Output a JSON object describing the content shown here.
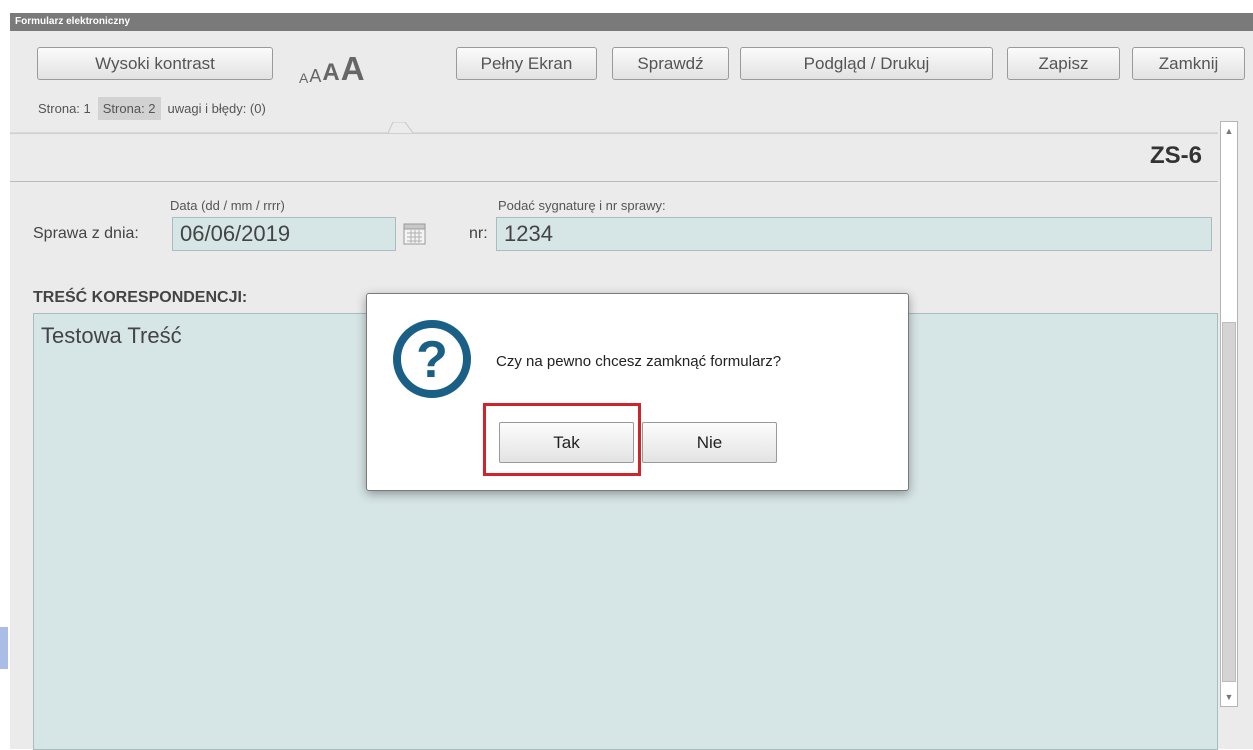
{
  "window": {
    "title": "Formularz elektroniczny"
  },
  "toolbar": {
    "high_contrast": "Wysoki kontrast",
    "font_sizes": [
      "A",
      "A",
      "A",
      "A"
    ],
    "fullscreen": "Pełny Ekran",
    "check": "Sprawdź",
    "preview_print": "Podgląd / Drukuj",
    "save": "Zapisz",
    "close": "Zamknij"
  },
  "tabs": [
    {
      "label": "Strona: 1"
    },
    {
      "label": "Strona: 2"
    },
    {
      "label": "uwagi i błędy: (0)"
    }
  ],
  "form": {
    "code": "ZS-6",
    "case_date_label": "Sprawa z dnia:",
    "date_format_hint": "Data (dd / mm / rrrr)",
    "date_value": "06/06/2019",
    "nr_label": "nr:",
    "signature_hint": "Podać sygnaturę i nr sprawy:",
    "nr_value": "1234",
    "content_heading": "TREŚĆ KORESPONDENCJI:",
    "content_value": "Testowa Treść"
  },
  "dialog": {
    "message": "Czy na pewno chcesz zamknąć formularz?",
    "yes_label": "Tak",
    "no_label": "Nie"
  },
  "colors": {
    "field_bg": "#d6e5e6",
    "titlebar_bg": "#7a7a7a",
    "question_icon": "#1a5f86",
    "highlight": "#d0242c"
  }
}
